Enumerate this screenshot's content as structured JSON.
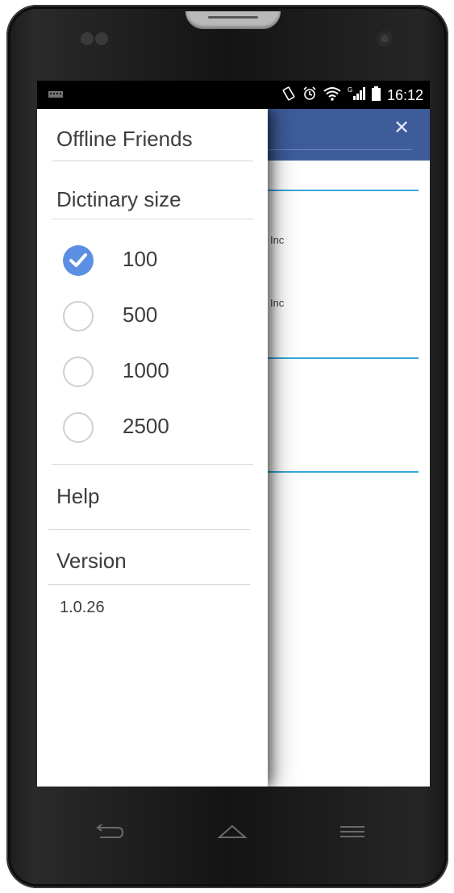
{
  "status_bar": {
    "time": "16:12",
    "icons": [
      "keyboard-icon",
      "vibrate-icon",
      "alarm-icon",
      "wifi-icon",
      "signal-icon",
      "battery-icon"
    ]
  },
  "app": {
    "header_color": "#3e5c9a",
    "list_items": [
      {
        "text": "ust Inc"
      },
      {
        "text": "ust Inc"
      }
    ]
  },
  "drawer": {
    "offline_friends": "Offline Friends",
    "dictionary_heading": "Dictinary size",
    "options": [
      {
        "label": "100",
        "checked": true
      },
      {
        "label": "500",
        "checked": false
      },
      {
        "label": "1000",
        "checked": false
      },
      {
        "label": "2500",
        "checked": false
      }
    ],
    "help": "Help",
    "version_label": "Version",
    "version_value": "1.0.26"
  },
  "colors": {
    "accent": "#5b8fe3",
    "divider_blue": "#35a7d8"
  }
}
